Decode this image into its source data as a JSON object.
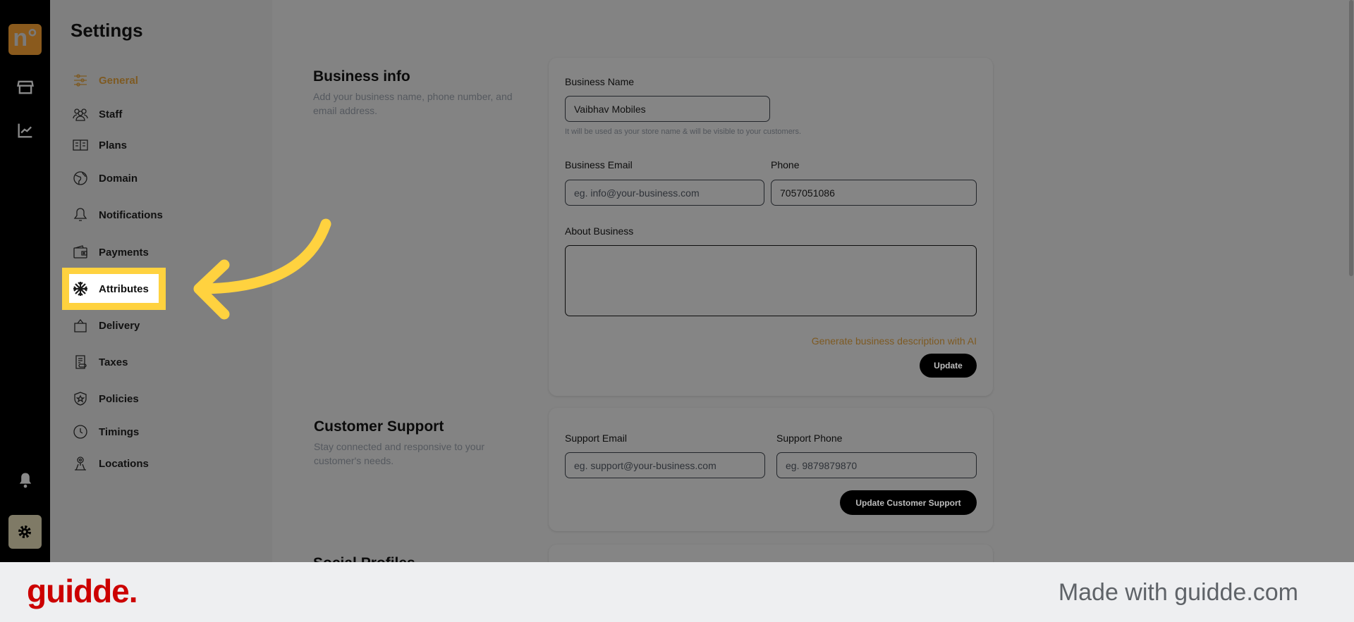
{
  "rail": {
    "logo": "n°",
    "items": [
      "store-icon",
      "chart-icon",
      "bell-icon",
      "gear-icon"
    ]
  },
  "settings": {
    "title": "Settings",
    "nav": [
      {
        "label": "General",
        "icon": "sliders-icon",
        "active": true
      },
      {
        "label": "Staff",
        "icon": "users-icon"
      },
      {
        "label": "Plans",
        "icon": "plans-icon"
      },
      {
        "label": "Domain",
        "icon": "globe-icon"
      },
      {
        "label": "Notifications",
        "icon": "bell-icon"
      },
      {
        "label": "Payments",
        "icon": "wallet-icon"
      },
      {
        "label": "Attributes",
        "icon": "snowflake-icon",
        "highlighted": true
      },
      {
        "label": "Delivery",
        "icon": "bag-icon"
      },
      {
        "label": "Taxes",
        "icon": "receipt-icon"
      },
      {
        "label": "Policies",
        "icon": "shield-icon"
      },
      {
        "label": "Timings",
        "icon": "clock-icon"
      },
      {
        "label": "Locations",
        "icon": "location-icon"
      }
    ]
  },
  "business": {
    "heading": "Business info",
    "desc": "Add your business name, phone number, and email address.",
    "name_label": "Business Name",
    "name_value": "Vaibhav Mobiles",
    "name_hint": "It will be used as your store name & will be visible to your customers.",
    "email_label": "Business Email",
    "email_placeholder": "eg. info@your-business.com",
    "phone_label": "Phone",
    "phone_value": "7057051086",
    "about_label": "About Business",
    "about_value": "",
    "ai_link": "Generate business description with AI",
    "update": "Update"
  },
  "support": {
    "heading": "Customer Support",
    "desc": "Stay connected and responsive to your customer's needs.",
    "email_label": "Support Email",
    "email_placeholder": "eg. support@your-business.com",
    "phone_label": "Support Phone",
    "phone_placeholder": "eg. 9879879870",
    "update": "Update Customer Support"
  },
  "social": {
    "heading": "Social Profiles"
  },
  "footer": {
    "brand": "guidde.",
    "made_with": "Made with guidde.com"
  },
  "colors": {
    "accent": "#8a5a1d",
    "highlight": "#ffd23f",
    "brand": "#cc0000"
  }
}
